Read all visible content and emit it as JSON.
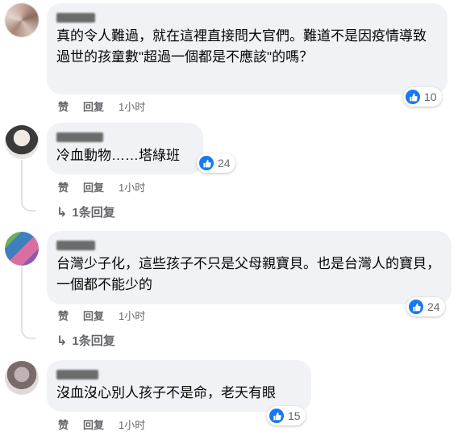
{
  "comments": [
    {
      "text": "真的令人難過，就在這裡直接問大官們。難道不是因疫情導致過世的孩童數\"超過一個都是不應該\"的嗎？",
      "likes": "10",
      "like_label": "赞",
      "reply_label": "回复",
      "time": "1小时"
    },
    {
      "text": "冷血動物……塔綠班",
      "likes": "24",
      "like_label": "赞",
      "reply_label": "回复",
      "time": "1小时",
      "replies": "1条回复"
    },
    {
      "text": "台灣少子化，這些孩子不只是父母親寶貝。也是台灣人的寶貝，一個都不能少的",
      "likes": "24",
      "like_label": "赞",
      "reply_label": "回复",
      "time": "1小时",
      "replies": "1条回复"
    },
    {
      "text": "沒血沒心別人孩子不是命，老天有眼",
      "likes": "15",
      "like_label": "赞",
      "reply_label": "回复",
      "time": "1小时"
    }
  ],
  "colors": {
    "accent": "#1877f2",
    "bubble": "#f0f2f5",
    "meta": "#65676b"
  },
  "icons": {
    "reaction": "like-icon",
    "reply": "reply-arrow-icon"
  }
}
